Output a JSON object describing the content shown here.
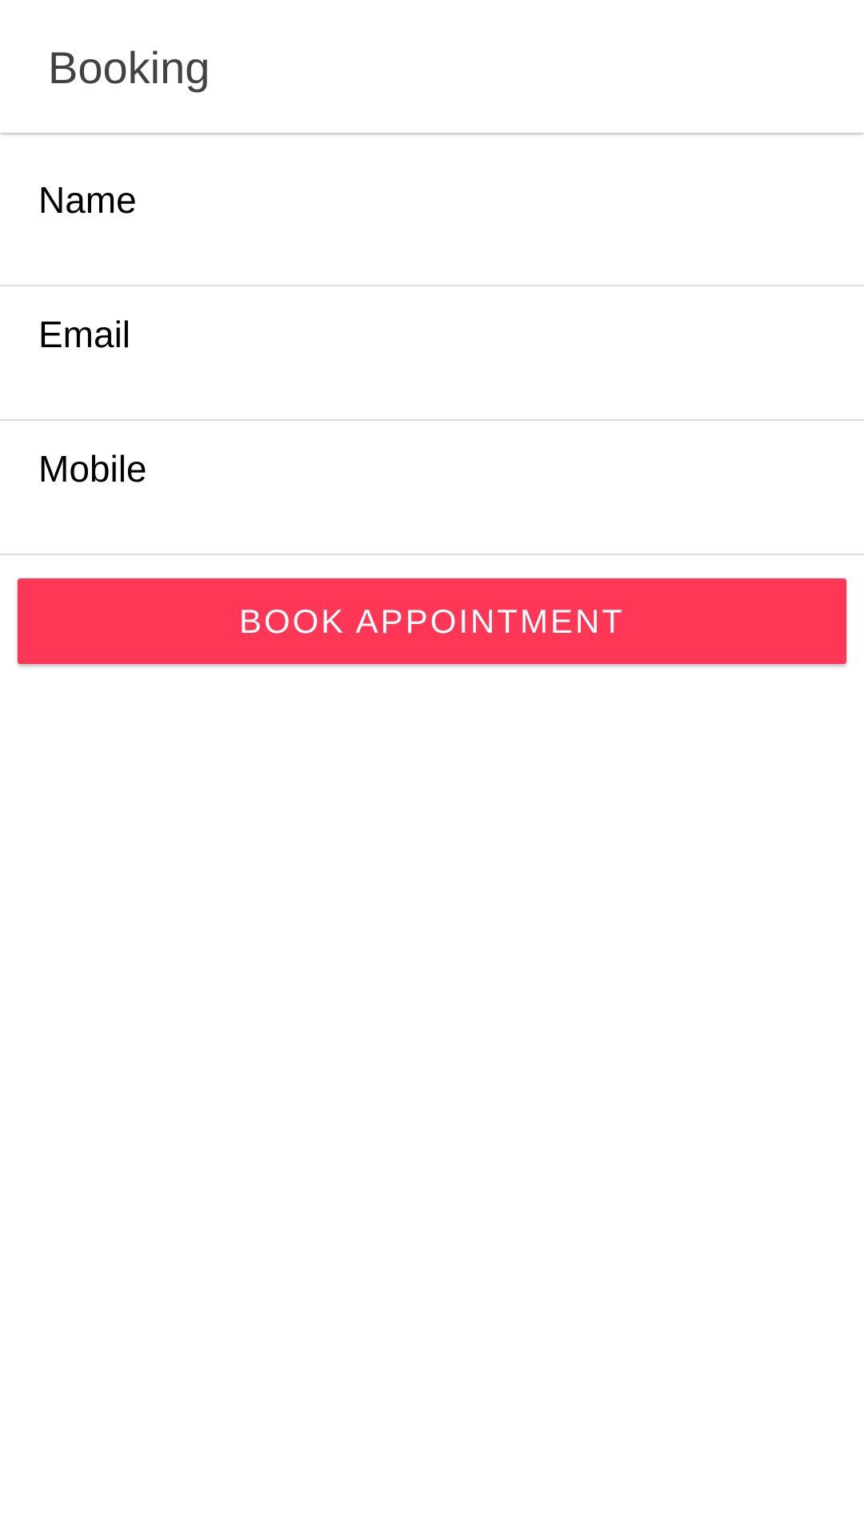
{
  "app_bar": {
    "title": "Booking"
  },
  "form": {
    "fields": [
      {
        "placeholder": "Name",
        "value": ""
      },
      {
        "placeholder": "Email",
        "value": ""
      },
      {
        "placeholder": "Mobile",
        "value": ""
      }
    ],
    "submit_label": "BOOK APPOINTMENT"
  },
  "colors": {
    "accent": "#ff3655",
    "divider": "#dddddd",
    "title_text": "#424242"
  }
}
